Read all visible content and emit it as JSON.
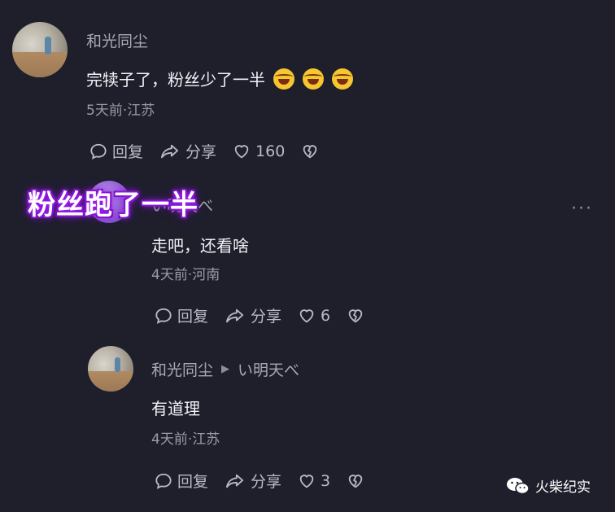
{
  "comments": [
    {
      "username": "和光同尘",
      "text": "完犊子了，粉丝少了一半",
      "emoji_count": 3,
      "meta": "5天前·江苏",
      "reply_label": "回复",
      "share_label": "分享",
      "like_count": "160"
    },
    {
      "username": "い明天べ",
      "text": "走吧，还看啥",
      "meta": "4天前·河南",
      "reply_label": "回复",
      "share_label": "分享",
      "like_count": "6"
    },
    {
      "username": "和光同尘",
      "reply_to": "い明天べ",
      "text": "有道理",
      "meta": "4天前·江苏",
      "reply_label": "回复",
      "share_label": "分享",
      "like_count": "3"
    }
  ],
  "overlay_caption": "粉丝跑了一半",
  "more_menu": "···",
  "watermark": "火柴纪实",
  "icons": [
    "comment-bubble-icon",
    "share-arrow-icon",
    "heart-icon",
    "broken-heart-icon",
    "caret-right-icon",
    "wechat-icon"
  ],
  "colors": {
    "background": "#1e1f2b",
    "overlay_glow": "#a020f0"
  }
}
